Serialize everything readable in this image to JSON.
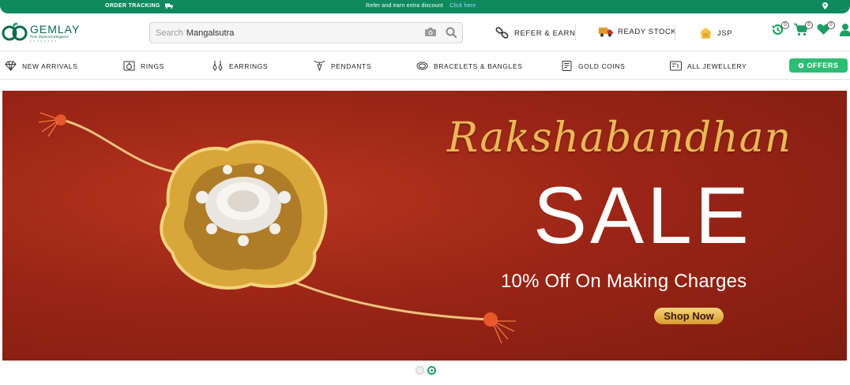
{
  "topbar": {
    "tracking": "ORDER TRACKING",
    "refer_text": "Refer and earn extra discount",
    "refer_link": "Click here"
  },
  "logo": {
    "brand": "GEMLAY",
    "tagline": "Pure Diamond Elegance"
  },
  "search": {
    "placeholder": "Search",
    "value": "Mangalsutra"
  },
  "header_links": {
    "refer": "REFER & EARN",
    "ready_stock": "READY STOCK",
    "jsp": "JSP"
  },
  "counters": {
    "recent": "0",
    "cart": "0",
    "wishlist": "0"
  },
  "nav": [
    {
      "label": "NEW ARRIVALS",
      "icon": "diamond-icon"
    },
    {
      "label": "RINGS",
      "icon": "ring-icon"
    },
    {
      "label": "EARRINGS",
      "icon": "earrings-icon"
    },
    {
      "label": "PENDANTS",
      "icon": "pendant-icon"
    },
    {
      "label": "BRACELETS & BANGLES",
      "icon": "bracelet-icon"
    },
    {
      "label": "GOLD COINS",
      "icon": "coin-icon"
    },
    {
      "label": "ALL JEWELLERY",
      "icon": "jewellery-icon"
    }
  ],
  "offers": "OFFERS",
  "banner": {
    "script_title": "Rakshabandhan",
    "headline": "SALE",
    "subline": "10% Off On Making Charges",
    "cta": "Shop Now"
  },
  "colors": {
    "brand_green": "#0f8a5f",
    "offers_green": "#2ebd74",
    "banner_red": "#9a2516",
    "gold": "#e9b857"
  }
}
